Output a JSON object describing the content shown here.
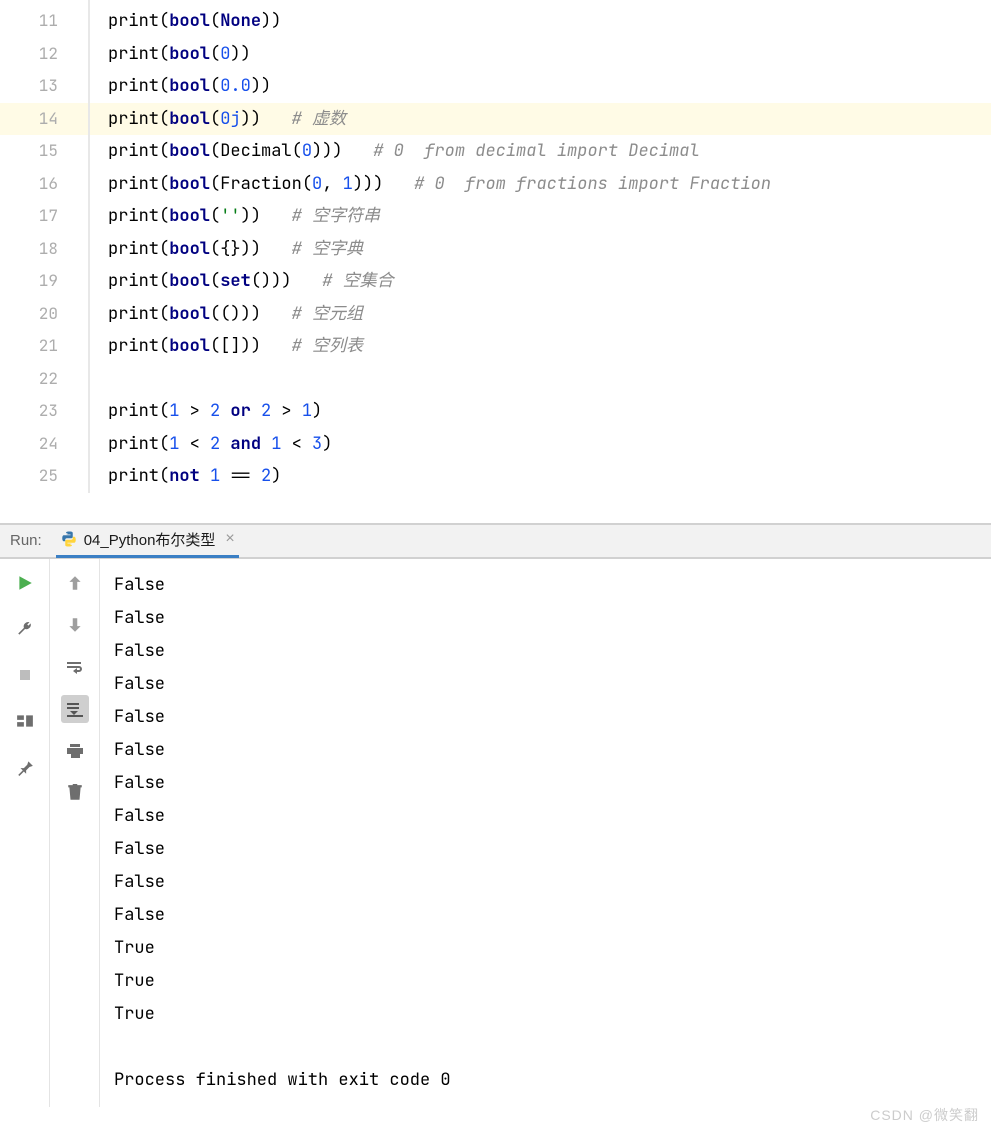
{
  "editor": {
    "highlighted_line": 14,
    "lines": [
      {
        "n": 11,
        "tokens": [
          {
            "t": "print",
            "c": "tk-call"
          },
          {
            "t": "(",
            "c": "tk-paren"
          },
          {
            "t": "bool",
            "c": "tk-bool"
          },
          {
            "t": "(",
            "c": "tk-paren"
          },
          {
            "t": "None",
            "c": "tk-kw"
          },
          {
            "t": "))",
            "c": "tk-paren"
          }
        ]
      },
      {
        "n": 12,
        "tokens": [
          {
            "t": "print",
            "c": "tk-call"
          },
          {
            "t": "(",
            "c": "tk-paren"
          },
          {
            "t": "bool",
            "c": "tk-bool"
          },
          {
            "t": "(",
            "c": "tk-paren"
          },
          {
            "t": "0",
            "c": "tk-num"
          },
          {
            "t": "))",
            "c": "tk-paren"
          }
        ]
      },
      {
        "n": 13,
        "tokens": [
          {
            "t": "print",
            "c": "tk-call"
          },
          {
            "t": "(",
            "c": "tk-paren"
          },
          {
            "t": "bool",
            "c": "tk-bool"
          },
          {
            "t": "(",
            "c": "tk-paren"
          },
          {
            "t": "0.0",
            "c": "tk-num"
          },
          {
            "t": "))",
            "c": "tk-paren"
          }
        ]
      },
      {
        "n": 14,
        "tokens": [
          {
            "t": "print",
            "c": "tk-call"
          },
          {
            "t": "(",
            "c": "tk-paren"
          },
          {
            "t": "bool",
            "c": "tk-bool"
          },
          {
            "t": "(",
            "c": "tk-paren"
          },
          {
            "t": "0j",
            "c": "tk-num"
          },
          {
            "t": "))",
            "c": "tk-paren"
          },
          {
            "t": "   ",
            "c": ""
          },
          {
            "t": "# 虚数",
            "c": "tk-comment"
          }
        ]
      },
      {
        "n": 15,
        "tokens": [
          {
            "t": "print",
            "c": "tk-call"
          },
          {
            "t": "(",
            "c": "tk-paren"
          },
          {
            "t": "bool",
            "c": "tk-bool"
          },
          {
            "t": "(",
            "c": "tk-paren"
          },
          {
            "t": "Decimal(",
            "c": "tk-cls"
          },
          {
            "t": "0",
            "c": "tk-num"
          },
          {
            "t": ")))",
            "c": "tk-paren"
          },
          {
            "t": "   ",
            "c": ""
          },
          {
            "t": "# 0  from decimal import Decimal",
            "c": "tk-comment"
          }
        ]
      },
      {
        "n": 16,
        "tokens": [
          {
            "t": "print",
            "c": "tk-call"
          },
          {
            "t": "(",
            "c": "tk-paren"
          },
          {
            "t": "bool",
            "c": "tk-bool"
          },
          {
            "t": "(",
            "c": "tk-paren"
          },
          {
            "t": "Fraction(",
            "c": "tk-cls"
          },
          {
            "t": "0",
            "c": "tk-num"
          },
          {
            "t": ", ",
            "c": "tk-op"
          },
          {
            "t": "1",
            "c": "tk-num"
          },
          {
            "t": ")))",
            "c": "tk-paren"
          },
          {
            "t": "   ",
            "c": ""
          },
          {
            "t": "# 0  from fractions import Fraction",
            "c": "tk-comment"
          }
        ]
      },
      {
        "n": 17,
        "tokens": [
          {
            "t": "print",
            "c": "tk-call"
          },
          {
            "t": "(",
            "c": "tk-paren"
          },
          {
            "t": "bool",
            "c": "tk-bool"
          },
          {
            "t": "(",
            "c": "tk-paren"
          },
          {
            "t": "''",
            "c": "tk-str"
          },
          {
            "t": "))",
            "c": "tk-paren"
          },
          {
            "t": "   ",
            "c": ""
          },
          {
            "t": "# 空字符串",
            "c": "tk-comment"
          }
        ]
      },
      {
        "n": 18,
        "tokens": [
          {
            "t": "print",
            "c": "tk-call"
          },
          {
            "t": "(",
            "c": "tk-paren"
          },
          {
            "t": "bool",
            "c": "tk-bool"
          },
          {
            "t": "({}))",
            "c": "tk-paren"
          },
          {
            "t": "   ",
            "c": ""
          },
          {
            "t": "# 空字典",
            "c": "tk-comment"
          }
        ]
      },
      {
        "n": 19,
        "tokens": [
          {
            "t": "print",
            "c": "tk-call"
          },
          {
            "t": "(",
            "c": "tk-paren"
          },
          {
            "t": "bool",
            "c": "tk-bool"
          },
          {
            "t": "(",
            "c": "tk-paren"
          },
          {
            "t": "set",
            "c": "tk-bool"
          },
          {
            "t": "()))",
            "c": "tk-paren"
          },
          {
            "t": "   ",
            "c": ""
          },
          {
            "t": "# 空集合",
            "c": "tk-comment"
          }
        ]
      },
      {
        "n": 20,
        "tokens": [
          {
            "t": "print",
            "c": "tk-call"
          },
          {
            "t": "(",
            "c": "tk-paren"
          },
          {
            "t": "bool",
            "c": "tk-bool"
          },
          {
            "t": "(()))",
            "c": "tk-paren"
          },
          {
            "t": "   ",
            "c": ""
          },
          {
            "t": "# 空元组",
            "c": "tk-comment"
          }
        ]
      },
      {
        "n": 21,
        "tokens": [
          {
            "t": "print",
            "c": "tk-call"
          },
          {
            "t": "(",
            "c": "tk-paren"
          },
          {
            "t": "bool",
            "c": "tk-bool"
          },
          {
            "t": "([]))",
            "c": "tk-paren"
          },
          {
            "t": "   ",
            "c": ""
          },
          {
            "t": "# 空列表",
            "c": "tk-comment"
          }
        ]
      },
      {
        "n": 22,
        "tokens": []
      },
      {
        "n": 23,
        "tokens": [
          {
            "t": "print",
            "c": "tk-call"
          },
          {
            "t": "(",
            "c": "tk-paren"
          },
          {
            "t": "1",
            "c": "tk-num"
          },
          {
            "t": " > ",
            "c": "tk-op"
          },
          {
            "t": "2",
            "c": "tk-num"
          },
          {
            "t": " ",
            "c": ""
          },
          {
            "t": "or",
            "c": "tk-kw"
          },
          {
            "t": " ",
            "c": ""
          },
          {
            "t": "2",
            "c": "tk-num"
          },
          {
            "t": " > ",
            "c": "tk-op"
          },
          {
            "t": "1",
            "c": "tk-num"
          },
          {
            "t": ")",
            "c": "tk-paren"
          }
        ]
      },
      {
        "n": 24,
        "tokens": [
          {
            "t": "print",
            "c": "tk-call"
          },
          {
            "t": "(",
            "c": "tk-paren"
          },
          {
            "t": "1",
            "c": "tk-num"
          },
          {
            "t": " < ",
            "c": "tk-op"
          },
          {
            "t": "2",
            "c": "tk-num"
          },
          {
            "t": " ",
            "c": ""
          },
          {
            "t": "and",
            "c": "tk-kw"
          },
          {
            "t": " ",
            "c": ""
          },
          {
            "t": "1",
            "c": "tk-num"
          },
          {
            "t": " < ",
            "c": "tk-op"
          },
          {
            "t": "3",
            "c": "tk-num"
          },
          {
            "t": ")",
            "c": "tk-paren"
          }
        ]
      },
      {
        "n": 25,
        "tokens": [
          {
            "t": "print",
            "c": "tk-call"
          },
          {
            "t": "(",
            "c": "tk-paren"
          },
          {
            "t": "not",
            "c": "tk-kw"
          },
          {
            "t": " ",
            "c": ""
          },
          {
            "t": "1",
            "c": "tk-num"
          },
          {
            "t": " == ",
            "c": "tk-op"
          },
          {
            "t": "2",
            "c": "tk-num"
          },
          {
            "t": ")",
            "c": "tk-paren"
          }
        ]
      }
    ]
  },
  "run": {
    "label": "Run:",
    "tab_name": "04_Python布尔类型",
    "output": [
      "False",
      "False",
      "False",
      "False",
      "False",
      "False",
      "False",
      "False",
      "False",
      "False",
      "False",
      "True",
      "True",
      "True",
      "",
      "Process finished with exit code 0"
    ]
  },
  "watermark": "CSDN @微笑翻"
}
